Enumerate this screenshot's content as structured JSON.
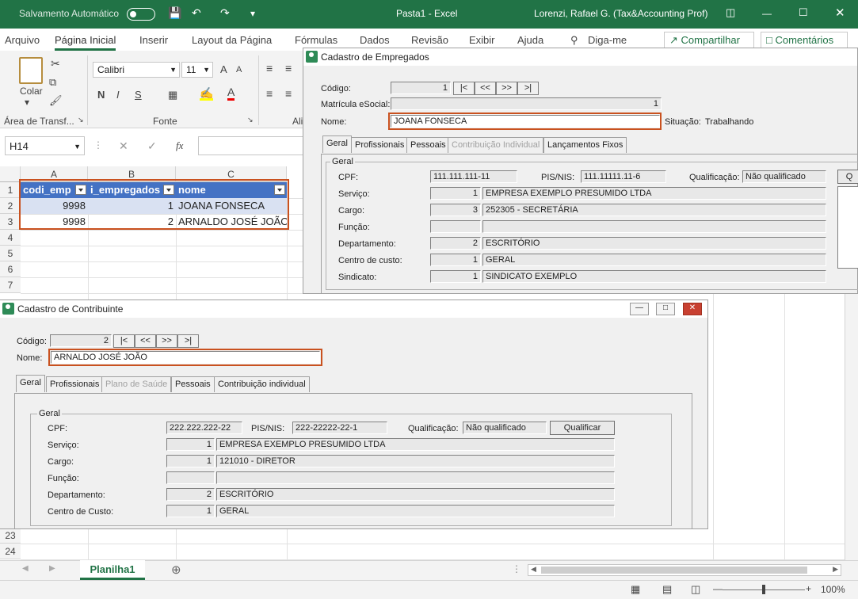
{
  "titlebar": {
    "autosave": "Salvamento Automático",
    "doc_title": "Pasta1  -  Excel",
    "user": "Lorenzi, Rafael G. (Tax&Accounting Prof)"
  },
  "menu": {
    "tabs": [
      "Arquivo",
      "Página Inicial",
      "Inserir",
      "Layout da Página",
      "Fórmulas",
      "Dados",
      "Revisão",
      "Exibir",
      "Ajuda"
    ],
    "tell_me": "Diga-me",
    "share": "Compartilhar",
    "comments": "Comentários"
  },
  "ribbon": {
    "paste": "Colar",
    "clipboard_group": "Área de Transf...",
    "font_name": "Calibri",
    "font_size": "11",
    "font_group": "Fonte",
    "align_group": "Ali",
    "bold": "N",
    "italic": "I",
    "underline": "S",
    "grow_font": "A",
    "shrink_font": "A"
  },
  "formula_bar": {
    "name_box": "H14",
    "fx": "fx",
    "value": ""
  },
  "sheet": {
    "columns": [
      "A",
      "B",
      "C"
    ],
    "header_row": [
      "codi_emp",
      "i_empregados",
      "nome"
    ],
    "rows": [
      [
        "9998",
        "1",
        "JOANA FONSECA"
      ],
      [
        "9998",
        "2",
        "ARNALDO JOSÉ JOÃO"
      ]
    ],
    "row_numbers": [
      "1",
      "2",
      "3",
      "4",
      "5",
      "6",
      "7",
      "23",
      "24"
    ]
  },
  "sheet_tab": "Planilha1",
  "zoom": "100%",
  "empregados": {
    "title": "Cadastro de Empregados",
    "codigo_label": "Código:",
    "codigo": "1",
    "nav": [
      "|<",
      "<<",
      ">>",
      ">|"
    ],
    "matricula_label": "Matrícula eSocial:",
    "matricula": "1",
    "nome_label": "Nome:",
    "nome": "JOANA FONSECA",
    "situacao_label": "Situação:",
    "situacao": "Trabalhando",
    "tabs": [
      "Geral",
      "Profissionais",
      "Pessoais",
      "Contribuição Individual",
      "Lançamentos Fixos"
    ],
    "group": "Geral",
    "cpf_label": "CPF:",
    "cpf": "111.111.111-11",
    "pis_label": "PIS/NIS:",
    "pis": "111.11111.11-6",
    "qualif_label": "Qualificação:",
    "qualif": "Não qualificado",
    "qualif_btn": "Q",
    "servico_label": "Serviço:",
    "servico_cod": "1",
    "servico": "EMPRESA EXEMPLO PRESUMIDO LTDA",
    "cargo_label": "Cargo:",
    "cargo_cod": "3",
    "cargo": "252305 - SECRETÁRIA",
    "funcao_label": "Função:",
    "depto_label": "Departamento:",
    "depto_cod": "2",
    "depto": "ESCRITÓRIO",
    "ccusto_label": "Centro de custo:",
    "ccusto_cod": "1",
    "ccusto": "GERAL",
    "sindicato_label": "Sindicato:",
    "sindicato_cod": "1",
    "sindicato": "SINDICATO EXEMPLO"
  },
  "contribuinte": {
    "title": "Cadastro de Contribuinte",
    "codigo_label": "Código:",
    "codigo": "2",
    "nav": [
      "|<",
      "<<",
      ">>",
      ">|"
    ],
    "nome_label": "Nome:",
    "nome": "ARNALDO JOSÉ JOÃO",
    "tabs": [
      "Geral",
      "Profissionais",
      "Plano de Saúde",
      "Pessoais",
      "Contribuição individual"
    ],
    "group": "Geral",
    "cpf_label": "CPF:",
    "cpf": "222.222.222-22",
    "pis_label": "PIS/NIS:",
    "pis": "222-22222-22-1",
    "qualif_label": "Qualificação:",
    "qualif": "Não qualificado",
    "qualif_btn": "Qualificar",
    "servico_label": "Serviço:",
    "servico_cod": "1",
    "servico": "EMPRESA EXEMPLO PRESUMIDO LTDA",
    "cargo_label": "Cargo:",
    "cargo_cod": "1",
    "cargo": "121010 - DIRETOR",
    "funcao_label": "Função:",
    "depto_label": "Departamento:",
    "depto_cod": "2",
    "depto": "ESCRITÓRIO",
    "ccusto_label": "Centro de Custo:",
    "ccusto_cod": "1",
    "ccusto": "GERAL"
  }
}
